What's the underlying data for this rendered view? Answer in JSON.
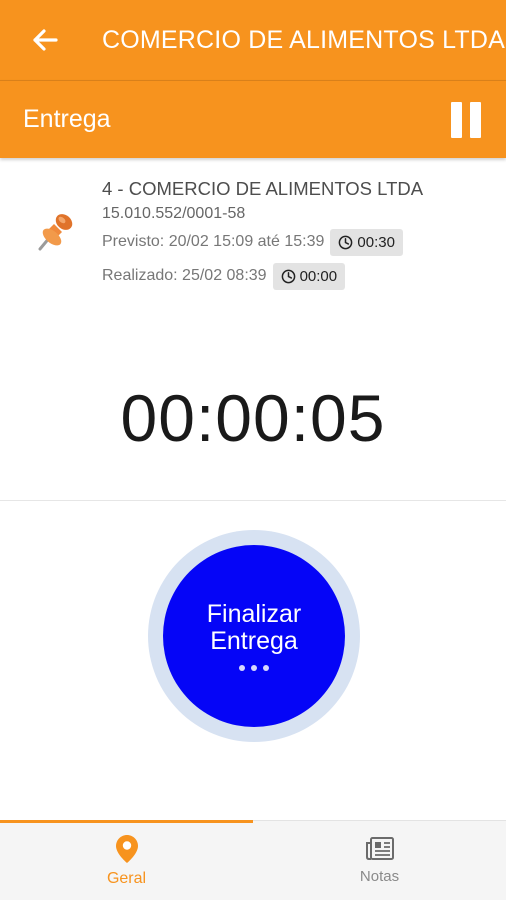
{
  "appbar": {
    "title": "COMERCIO DE ALIMENTOS LTDA",
    "back_icon": "arrow-left-icon"
  },
  "subbar": {
    "title": "Entrega",
    "pause_icon": "pause-icon"
  },
  "stop": {
    "name": "4 - COMERCIO DE ALIMENTOS LTDA",
    "document": "15.010.552/0001-58",
    "planned_label": "Previsto: 20/02 15:09 até 15:39",
    "planned_duration": "00:30",
    "actual_label": "Realizado: 25/02 08:39",
    "actual_duration": "00:00",
    "icon": "pushpin-icon"
  },
  "timer": "00:00:05",
  "action": {
    "line1": "Finalizar",
    "line2": "Entrega",
    "color": "#0505f7",
    "ring_color": "#d7e2f2"
  },
  "nav": {
    "items": [
      {
        "label": "Geral",
        "icon": "location-pin-icon",
        "active": true
      },
      {
        "label": "Notas",
        "icon": "newspaper-icon",
        "active": false
      }
    ]
  },
  "colors": {
    "accent": "#f7931e"
  }
}
